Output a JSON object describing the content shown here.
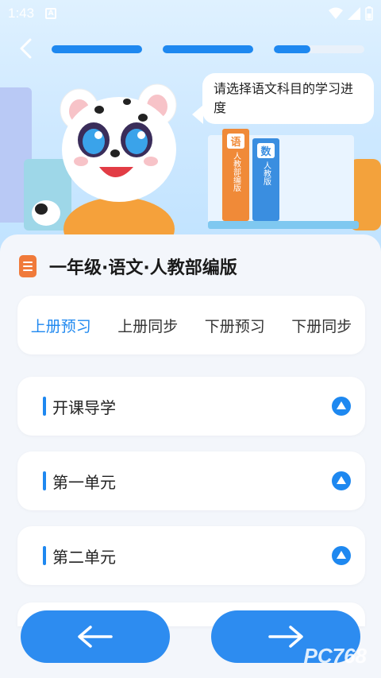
{
  "status": {
    "time": "1:43",
    "notif": "A"
  },
  "progress": {
    "steps": 4,
    "completed": 3,
    "last_fraction": 0.4
  },
  "bubble": {
    "text": "请选择语文科目的学习进度"
  },
  "books": {
    "chinese": "语",
    "chinese_sub": "人教部编版",
    "math": "数",
    "math_sub": "人教版"
  },
  "header": {
    "title": "一年级·语文·人教部编版"
  },
  "tabs": [
    {
      "label": "上册预习",
      "active": true
    },
    {
      "label": "上册同步",
      "active": false
    },
    {
      "label": "下册预习",
      "active": false
    },
    {
      "label": "下册同步",
      "active": false
    }
  ],
  "units": [
    {
      "label": "开课导学"
    },
    {
      "label": "第一单元"
    },
    {
      "label": "第二单元"
    }
  ],
  "nav": {
    "prev_icon": "arrow-left-icon",
    "next_icon": "arrow-right-icon"
  },
  "watermark": "PC768",
  "colors": {
    "accent": "#1e88f0",
    "orange": "#f07a3a",
    "button": "#2d8cf0"
  }
}
